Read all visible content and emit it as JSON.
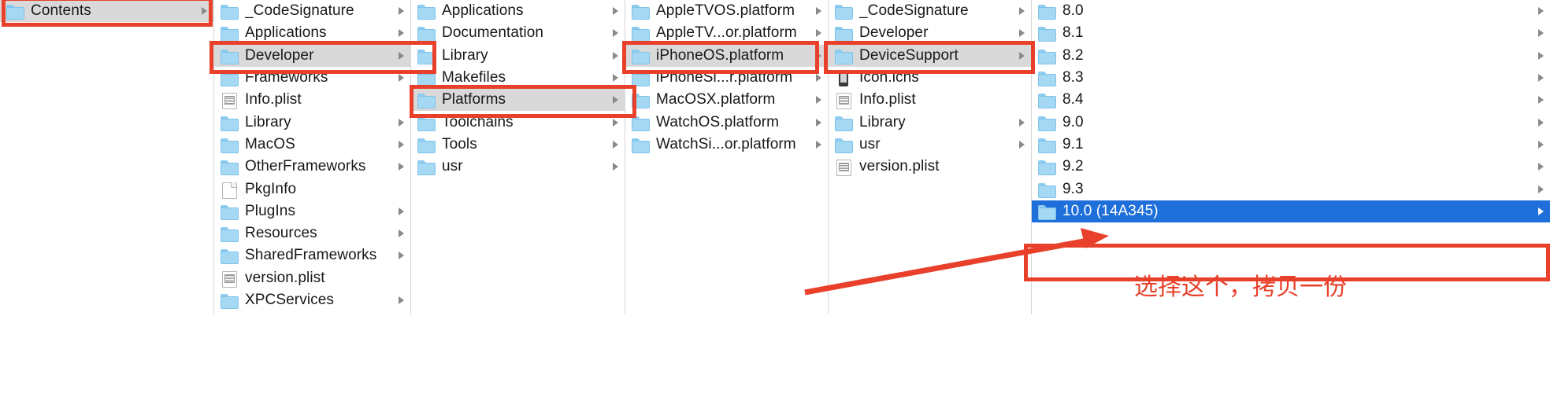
{
  "window": {
    "title": "Finder Column View",
    "accent_selected_blue": "#1e6fd9",
    "accent_selected_gray": "#d9d9d9",
    "annotation_red": "#e8402a"
  },
  "columns": [
    {
      "name": "column-contents",
      "rows": [
        {
          "label": "Contents",
          "icon": "folder-icon",
          "chevron": true,
          "state": "selected-gray"
        }
      ]
    },
    {
      "name": "column-contents-children",
      "rows": [
        {
          "label": "_CodeSignature",
          "icon": "folder-icon",
          "chevron": true,
          "state": "normal"
        },
        {
          "label": "Applications",
          "icon": "folder-icon",
          "chevron": true,
          "state": "normal"
        },
        {
          "label": "Developer",
          "icon": "folder-icon",
          "chevron": true,
          "state": "selected-gray"
        },
        {
          "label": "Frameworks",
          "icon": "folder-icon",
          "chevron": true,
          "state": "normal"
        },
        {
          "label": "Info.plist",
          "icon": "plist-icon",
          "chevron": false,
          "state": "normal"
        },
        {
          "label": "Library",
          "icon": "folder-icon",
          "chevron": true,
          "state": "normal"
        },
        {
          "label": "MacOS",
          "icon": "folder-icon",
          "chevron": true,
          "state": "normal"
        },
        {
          "label": "OtherFrameworks",
          "icon": "folder-icon",
          "chevron": true,
          "state": "normal"
        },
        {
          "label": "PkgInfo",
          "icon": "document-icon",
          "chevron": false,
          "state": "normal"
        },
        {
          "label": "PlugIns",
          "icon": "folder-icon",
          "chevron": true,
          "state": "normal"
        },
        {
          "label": "Resources",
          "icon": "folder-icon",
          "chevron": true,
          "state": "normal"
        },
        {
          "label": "SharedFrameworks",
          "icon": "folder-icon",
          "chevron": true,
          "state": "normal"
        },
        {
          "label": "version.plist",
          "icon": "plist-icon",
          "chevron": false,
          "state": "normal"
        },
        {
          "label": "XPCServices",
          "icon": "folder-icon",
          "chevron": true,
          "state": "normal"
        }
      ]
    },
    {
      "name": "column-developer-children",
      "rows": [
        {
          "label": "Applications",
          "icon": "folder-icon",
          "chevron": true,
          "state": "normal"
        },
        {
          "label": "Documentation",
          "icon": "folder-icon",
          "chevron": true,
          "state": "normal"
        },
        {
          "label": "Library",
          "icon": "folder-icon",
          "chevron": true,
          "state": "normal"
        },
        {
          "label": "Makefiles",
          "icon": "folder-icon",
          "chevron": true,
          "state": "normal"
        },
        {
          "label": "Platforms",
          "icon": "folder-icon",
          "chevron": true,
          "state": "selected-gray"
        },
        {
          "label": "Toolchains",
          "icon": "folder-icon",
          "chevron": true,
          "state": "normal"
        },
        {
          "label": "Tools",
          "icon": "folder-icon",
          "chevron": true,
          "state": "normal"
        },
        {
          "label": "usr",
          "icon": "folder-icon",
          "chevron": true,
          "state": "normal"
        }
      ]
    },
    {
      "name": "column-platforms-children",
      "rows": [
        {
          "label": "AppleTVOS.platform",
          "icon": "folder-icon",
          "chevron": true,
          "state": "normal"
        },
        {
          "label": "AppleTV...or.platform",
          "icon": "folder-icon",
          "chevron": true,
          "state": "normal"
        },
        {
          "label": "iPhoneOS.platform",
          "icon": "folder-icon",
          "chevron": true,
          "state": "selected-gray"
        },
        {
          "label": "iPhoneSi...r.platform",
          "icon": "folder-icon",
          "chevron": true,
          "state": "normal"
        },
        {
          "label": "MacOSX.platform",
          "icon": "folder-icon",
          "chevron": true,
          "state": "normal"
        },
        {
          "label": "WatchOS.platform",
          "icon": "folder-icon",
          "chevron": true,
          "state": "normal"
        },
        {
          "label": "WatchSi...or.platform",
          "icon": "folder-icon",
          "chevron": true,
          "state": "normal"
        }
      ]
    },
    {
      "name": "column-iphoneos-children",
      "rows": [
        {
          "label": "_CodeSignature",
          "icon": "folder-icon",
          "chevron": true,
          "state": "normal"
        },
        {
          "label": "Developer",
          "icon": "folder-icon",
          "chevron": true,
          "state": "normal"
        },
        {
          "label": "DeviceSupport",
          "icon": "folder-icon",
          "chevron": true,
          "state": "selected-gray"
        },
        {
          "label": "Icon.icns",
          "icon": "icns-icon",
          "chevron": false,
          "state": "normal"
        },
        {
          "label": "Info.plist",
          "icon": "plist-icon",
          "chevron": false,
          "state": "normal"
        },
        {
          "label": "Library",
          "icon": "folder-icon",
          "chevron": true,
          "state": "normal"
        },
        {
          "label": "usr",
          "icon": "folder-icon",
          "chevron": true,
          "state": "normal"
        },
        {
          "label": "version.plist",
          "icon": "plist-icon",
          "chevron": false,
          "state": "normal"
        }
      ]
    },
    {
      "name": "column-devicesupport-children",
      "rows": [
        {
          "label": "8.0",
          "icon": "folder-icon",
          "chevron": true,
          "state": "normal"
        },
        {
          "label": "8.1",
          "icon": "folder-icon",
          "chevron": true,
          "state": "normal"
        },
        {
          "label": "8.2",
          "icon": "folder-icon",
          "chevron": true,
          "state": "normal"
        },
        {
          "label": "8.3",
          "icon": "folder-icon",
          "chevron": true,
          "state": "normal"
        },
        {
          "label": "8.4",
          "icon": "folder-icon",
          "chevron": true,
          "state": "normal"
        },
        {
          "label": "9.0",
          "icon": "folder-icon",
          "chevron": true,
          "state": "normal"
        },
        {
          "label": "9.1",
          "icon": "folder-icon",
          "chevron": true,
          "state": "normal"
        },
        {
          "label": "9.2",
          "icon": "folder-icon",
          "chevron": true,
          "state": "normal"
        },
        {
          "label": "9.3",
          "icon": "folder-icon",
          "chevron": true,
          "state": "normal"
        },
        {
          "label": "10.0 (14A345)",
          "icon": "folder-icon",
          "chevron": true,
          "state": "selected-blue"
        }
      ]
    }
  ],
  "annotations": {
    "callout_text": "选择这个，拷贝一份"
  }
}
